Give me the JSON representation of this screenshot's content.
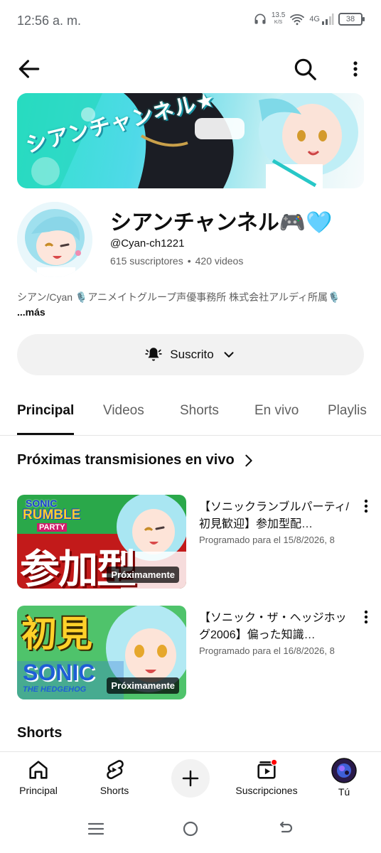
{
  "status_bar": {
    "time": "12:56 a. m.",
    "net_speed_value": "13.5",
    "net_speed_unit": "K/S",
    "network_type": "4G",
    "battery": "38"
  },
  "channel": {
    "banner_text": "シアンチャンネル★",
    "name": "シアンチャンネル🎮🩵",
    "handle": "@Cyan-ch1221",
    "subscribers": "615 suscriptores",
    "separator": "•",
    "videos": "420 videos",
    "description": "シアン/Cyan 🎙️アニメイトグループ声優事務所 株式会社アルディ所属🎙️",
    "more_label": "...más",
    "subscribe_label": "Suscrito"
  },
  "tabs": [
    {
      "label": "Principal",
      "active": true
    },
    {
      "label": "Videos",
      "active": false
    },
    {
      "label": "Shorts",
      "active": false
    },
    {
      "label": "En vivo",
      "active": false
    },
    {
      "label": "Playlis",
      "active": false
    }
  ],
  "upcoming": {
    "title": "Próximas transmisiones en vivo",
    "videos": [
      {
        "title": "【ソニックランブルパーティ/初見歓迎】参加型配…",
        "meta": "Programado para el 15/8/2026, 8",
        "badge": "Próximamente",
        "thumb_text_top": "SONIC",
        "thumb_text_mid": "RUMBLE",
        "thumb_text_sub": "PARTY",
        "thumb_text_big": "参加型"
      },
      {
        "title": "【ソニック・ザ・ヘッジホッグ2006】偏った知識…",
        "meta": "Programado para el 16/8/2026, 8",
        "badge": "Próximamente",
        "thumb_text_top": "初見",
        "thumb_text_mid": "SONIC",
        "thumb_text_sub": "THE HEDGEHOG"
      }
    ]
  },
  "shorts_heading": "Shorts",
  "bottom_nav": [
    {
      "label": "Principal",
      "icon": "home-icon"
    },
    {
      "label": "Shorts",
      "icon": "shorts-icon"
    },
    {
      "label": "",
      "icon": "plus-icon"
    },
    {
      "label": "Suscripciones",
      "icon": "subscriptions-icon"
    },
    {
      "label": "Tú",
      "icon": "profile-avatar"
    }
  ],
  "colors": {
    "accent_red": "#ff0000",
    "text_primary": "#0f0f0f",
    "text_secondary": "#606060",
    "chip_bg": "#f2f2f2"
  }
}
